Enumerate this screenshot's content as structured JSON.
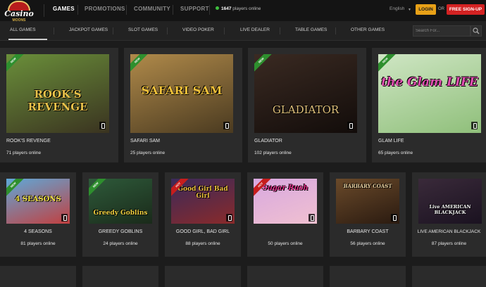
{
  "brand": {
    "logo_text": "Casino",
    "logo_sub": "MOONS"
  },
  "header": {
    "nav": [
      "GAMES",
      "PROMOTIONS",
      "COMMUNITY",
      "SUPPORT"
    ],
    "online_count": "1647",
    "online_text": "players online",
    "language": "English",
    "login_label": "LOGIN",
    "or_label": "OR",
    "signup_label": "FREE SIGN-UP"
  },
  "categories": [
    "ALL GAMES",
    "JACKPOT GAMES",
    "SLOT GAMES",
    "VIDEO POKER",
    "LIVE DEALER",
    "TABLE GAMES",
    "OTHER GAMES"
  ],
  "search": {
    "placeholder": "Search For..."
  },
  "featured": [
    {
      "name": "ROOK'S REVENGE",
      "players": "71 players online",
      "badge": "NEW",
      "art_title": "ROOK'S REVENGE",
      "colors": [
        "#6a8f3a",
        "#3a3320"
      ]
    },
    {
      "name": "SAFARI SAM",
      "players": "25 players online",
      "badge": "NEW",
      "art_title": "SAFARI SAM",
      "colors": [
        "#b08a4a",
        "#4a3a20"
      ]
    },
    {
      "name": "GLADIATOR",
      "players": "102 players online",
      "badge": "NEW",
      "art_title": "GLADIATOR",
      "colors": [
        "#3a2a22",
        "#120c0a"
      ]
    },
    {
      "name": "GLAM LIFE",
      "players": "65 players online",
      "badge": "NEW",
      "art_title": "the Glam LIFE",
      "colors": [
        "#cfe6c4",
        "#8fbf7a"
      ]
    }
  ],
  "games": [
    {
      "name": "4 SEASONS",
      "players": "81 players online",
      "badge": "NEW",
      "art_title": "4 SEASONS",
      "colors": [
        "#5fa8d8",
        "#c14040"
      ]
    },
    {
      "name": "GREEDY GOBLINS",
      "players": "24 players online",
      "badge": "NEW",
      "art_title": "Greedy Goblins",
      "colors": [
        "#2e5a3a",
        "#1a2a1a"
      ]
    },
    {
      "name": "GOOD GIRL, BAD GIRL",
      "players": "88 players online",
      "badge": "HOT",
      "art_title": "Good Girl Bad Girl",
      "colors": [
        "#3a2a5a",
        "#8a2a2a"
      ]
    },
    {
      "name": "",
      "players": "50 players online",
      "badge": "HOT",
      "art_title": "Sugar Rush",
      "colors": [
        "#d8a8e0",
        "#f0c0d0"
      ]
    },
    {
      "name": "BARBARY COAST",
      "players": "56 players online",
      "badge": "",
      "art_title": "BARBARY COAST",
      "colors": [
        "#6a4a2a",
        "#2a1a10"
      ]
    },
    {
      "name": "LIVE AMERICAN BLACKJACK",
      "players": "87 players online",
      "badge": "",
      "art_title": "Live AMERICAN BLACKJACK",
      "colors": [
        "#3a2a3a",
        "#1a1220"
      ]
    }
  ],
  "accent": "#e8a117",
  "signup_color": "#d32222"
}
